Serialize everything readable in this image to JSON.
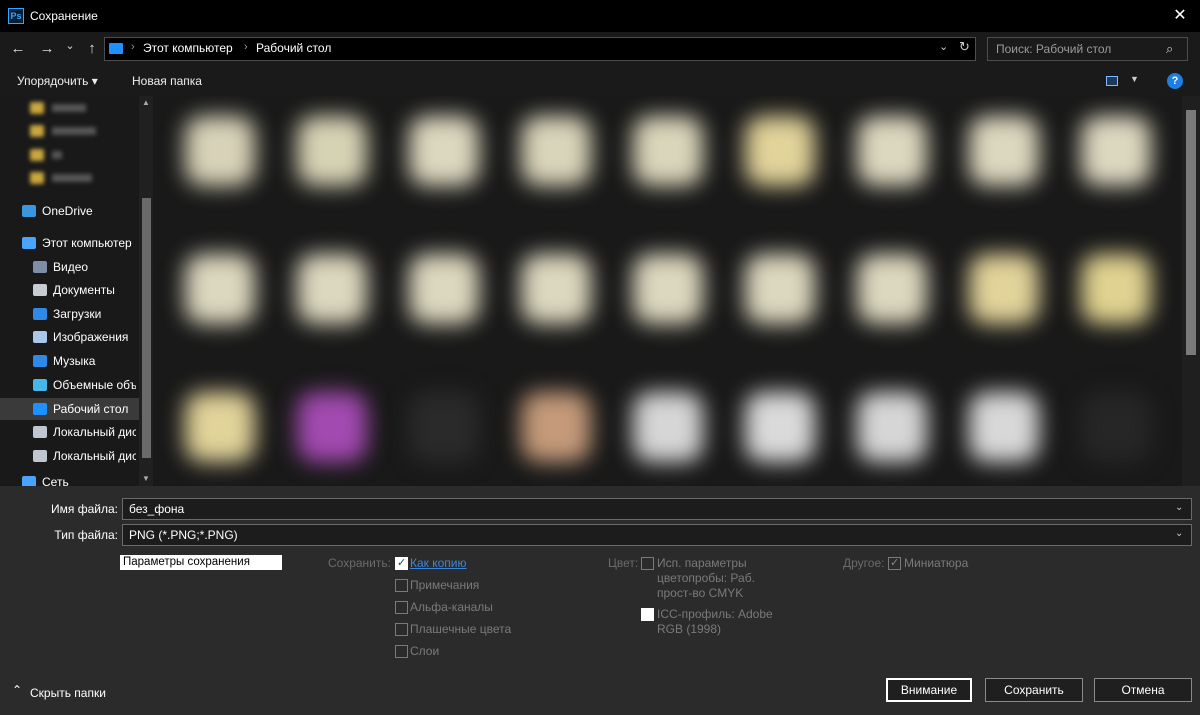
{
  "window": {
    "title": "Сохранение",
    "app_icon": "Ps",
    "close_icon": "✕"
  },
  "nav": {
    "back_icon": "←",
    "forward_icon": "→",
    "recent_icon": "⌄",
    "up_icon": "↑",
    "breadcrumbs": [
      "Этот компьютер",
      "Рабочий стол"
    ],
    "crumb_sep": "›",
    "chevron_icon": "⌄",
    "refresh_icon": "↻",
    "search_placeholder": "Поиск: Рабочий стол",
    "search_icon": "⌕"
  },
  "toolbar": {
    "organize_label": "Упорядочить ▾",
    "new_folder_label": "Новая папка",
    "view_chev": "▼",
    "help_icon": "?"
  },
  "sidebar": {
    "items": [
      {
        "label": "OneDrive",
        "icon": "cloud-icon",
        "color": "#3a96dd"
      },
      {
        "label": "Этот компьютер",
        "icon": "computer-icon",
        "color": "#4aa3ff"
      },
      {
        "label": "Видео",
        "icon": "video-icon",
        "color": "#7d8ea6"
      },
      {
        "label": "Документы",
        "icon": "document-icon",
        "color": "#c7ccd4"
      },
      {
        "label": "Загрузки",
        "icon": "download-icon",
        "color": "#2e8ae6"
      },
      {
        "label": "Изображения",
        "icon": "image-icon",
        "color": "#a9c7e8"
      },
      {
        "label": "Музыка",
        "icon": "music-icon",
        "color": "#2e8ae6"
      },
      {
        "label": "Объемные объ",
        "icon": "3d-objects-icon",
        "color": "#49b6e8"
      },
      {
        "label": "Рабочий стол",
        "icon": "desktop-icon",
        "color": "#1e90ff"
      },
      {
        "label": "Локальный дис",
        "icon": "drive-icon",
        "color": "#bfc6cf"
      },
      {
        "label": "Локальный дис",
        "icon": "drive-icon",
        "color": "#bfc6cf"
      },
      {
        "label": "Сеть",
        "icon": "network-icon",
        "color": "#4aa3ff"
      }
    ],
    "scroll_up": "▲",
    "scroll_down": "▼"
  },
  "file_tiles": [
    "#d8d3b8",
    "#d6d3b5",
    "#dcd8bf",
    "#d9d5ba",
    "#dad6bb",
    "#e2d39a",
    "#dcd8bf",
    "#dcd8bf",
    "#dcd8c0",
    "#dcd8bf",
    "#dcd8bf",
    "#dcd8bf",
    "#dcd8bf",
    "#dcd8bf",
    "#dcd8bf",
    "#dcd8bf",
    "#e2d39a",
    "#e0d290",
    "#e2d39a",
    "#a24ab0",
    "#2a2a2a",
    "#c49a7a",
    "#d6d6d6",
    "#dadada",
    "#d6d6d6",
    "#d8d8d8",
    "#262626"
  ],
  "form": {
    "filename_label": "Имя файла:",
    "filename_value": "без_фона",
    "filetype_label": "Тип файла:",
    "filetype_value": "PNG (*.PNG;*.PNG)",
    "dropdown_icon": "⌄",
    "options_label": "Параметры сохранения",
    "save_group": "Сохранить:",
    "save_options": [
      {
        "label": "Как копию",
        "checked": true,
        "link": true
      },
      {
        "label": "Примечания",
        "checked": false,
        "link": false
      },
      {
        "label": "Альфа-каналы",
        "checked": false,
        "link": false
      },
      {
        "label": "Плашечные цвета",
        "checked": false,
        "link": false
      },
      {
        "label": "Слои",
        "checked": false,
        "link": false
      }
    ],
    "color_group": "Цвет:",
    "proof_label_1": "Исп. параметры",
    "proof_label_2": "цветопробы:  Раб.",
    "proof_label_3": "прост-во CMYK",
    "icc_label_1": "ICC-профиль:  Adobe",
    "icc_label_2": "RGB (1998)",
    "other_group": "Другое:",
    "thumbnail_label": "Миниатюра",
    "check_mark": "✓"
  },
  "footer": {
    "hide_folders": "Скрыть папки",
    "hide_icon": "⌃",
    "btn_warning": "Внимание",
    "btn_save": "Сохранить",
    "btn_cancel": "Отмена"
  }
}
